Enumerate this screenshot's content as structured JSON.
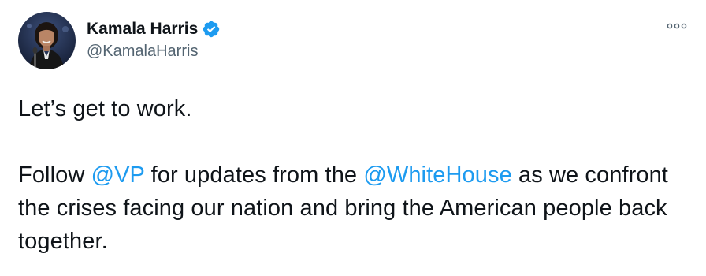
{
  "author": {
    "display_name": "Kamala Harris",
    "handle": "@KamalaHarris",
    "verified": true,
    "avatar_icon": "profile-photo"
  },
  "menu": {
    "icon": "more-options-icon"
  },
  "tweet": {
    "line1": "Let’s get to work.",
    "follow_prefix": "Follow ",
    "mention_vp": "@VP",
    "middle_text": " for updates from the ",
    "mention_whitehouse": "@WhiteHouse",
    "suffix_text": " as we confront the crises facing our nation and bring the American people back together."
  },
  "colors": {
    "text": "#0f1419",
    "secondary": "#536471",
    "link": "#1d9bf0",
    "verified": "#1d9bf0"
  }
}
